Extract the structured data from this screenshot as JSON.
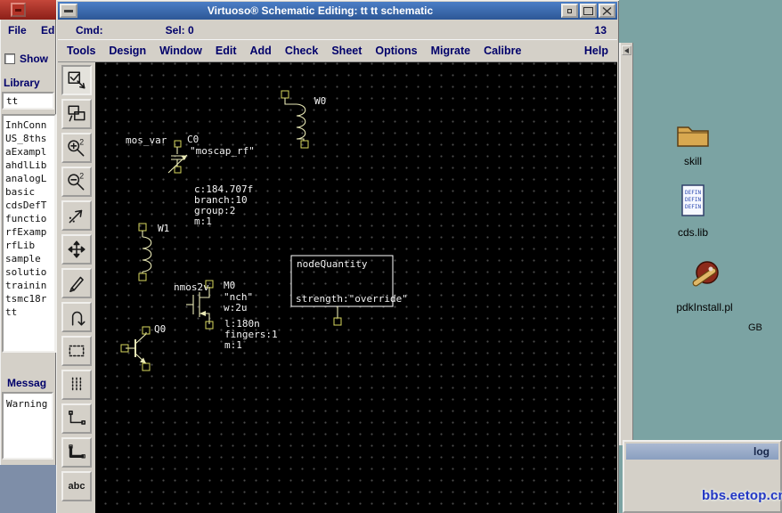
{
  "library_window": {
    "menu": {
      "file": "File",
      "edit": "Ed"
    },
    "show_label": "Show",
    "library_label": "Library",
    "filter_value": "tt",
    "items": [
      "InhConn",
      "US_8ths",
      "aExampl",
      "ahdlLib",
      "analogL",
      "basic",
      "cdsDefT",
      "functio",
      "rfExamp",
      "rfLib",
      "sample",
      "solutio",
      "trainin",
      "tsmc18r",
      "tt"
    ],
    "messages_label": "Messag",
    "warning_text": "Warning"
  },
  "virtuoso": {
    "title": "Virtuoso® Schematic Editing: tt tt schematic",
    "cmd_label": "Cmd:",
    "sel_label": "Sel: 0",
    "counter": "13",
    "menus": [
      "Tools",
      "Design",
      "Window",
      "Edit",
      "Add",
      "Check",
      "Sheet",
      "Options",
      "Migrate",
      "Calibre"
    ],
    "help": "Help",
    "toolbar": {
      "zoom_badge": "2",
      "label_tool": "abc"
    }
  },
  "schematic": {
    "w0_label": "W0",
    "w1_label": "W1",
    "mosvar_lib": "mos_var",
    "mosvar_inst": "C0",
    "mosvar_cell": "\"moscap_rf\"",
    "mosvar_prop1": "c:184.707f",
    "mosvar_prop2": "branch:10",
    "mosvar_prop3": "group:2",
    "mosvar_prop4": "m:1",
    "nmos_lib": "nmos2v",
    "nmos_inst": "M0",
    "nmos_cell": "\"nch\"",
    "nmos_w": "w:2u",
    "nmos_l": "l:180n",
    "nmos_fingers": "fingers:1",
    "nmos_m": "m:1",
    "bjt_inst": "Q0",
    "note_title": "nodeQuantity",
    "note_text": "strength:\"override\""
  },
  "desktop": {
    "icon_skill": "skill",
    "icon_cdslib": "cds.lib",
    "cdslib_icon_text": "DEFIN",
    "icon_pdk": "pdkInstall.pl",
    "gb_label": "GB",
    "log_title": "log",
    "watermark": "bbs.eetop.cn"
  }
}
